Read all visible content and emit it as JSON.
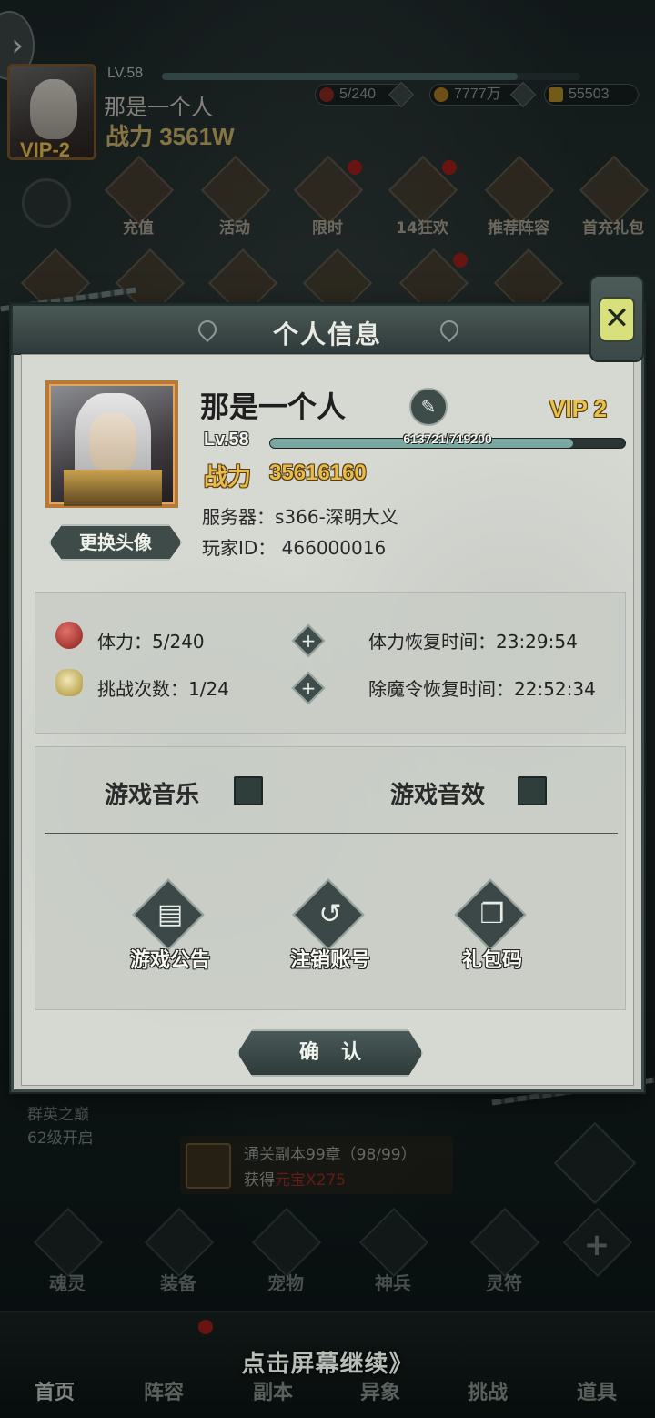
{
  "background": {
    "header": {
      "level": "LV.58",
      "name": "那是一个人",
      "power": "战力 3561W",
      "vip": "VIP-2",
      "stamina": "5/240",
      "gold": "7777万",
      "ingots": "55503"
    },
    "event_icons": [
      "充值",
      "活动",
      "限时",
      "14狂欢",
      "推荐阵容",
      "首充礼包"
    ],
    "unlock_text": [
      "群英之巅",
      "62级开启"
    ],
    "quest": {
      "line1": "通关副本99章（98/99）",
      "line2_prefix": "获得",
      "line2_reward": "元宝X275"
    },
    "menu": [
      "魂灵",
      "装备",
      "宠物",
      "神兵",
      "灵符"
    ],
    "nav": [
      "首页",
      "阵容",
      "副本",
      "异象",
      "挑战",
      "道具"
    ],
    "continue_text": "点击屏幕继续》"
  },
  "modal": {
    "title": "个人信息",
    "player_name": "那是一个人",
    "vip": "VIP 2",
    "level": "Lv.58",
    "exp_text": "613721/719200",
    "exp_fraction": 0.853,
    "power_label": "战力",
    "power_value": "35616160",
    "server": "服务器：s366-深明大义",
    "player_id": "玩家ID： 466000016",
    "change_avatar": "更换头像",
    "stamina": "体力：5/240",
    "stamina_recover": "体力恢复时间：23:29:54",
    "challenge": "挑战次数：1/24",
    "demon_recover": "除魔令恢复时间：22:52:34",
    "music_label": "游戏音乐",
    "sound_label": "游戏音效",
    "actions": [
      "游戏公告",
      "注销账号",
      "礼包码"
    ],
    "confirm": "确认"
  },
  "colors": {
    "gold": "#e4bd4c",
    "panel": "#d6d8d2",
    "dark_teal": "#3e4b49",
    "red_dot": "#a3201c"
  }
}
